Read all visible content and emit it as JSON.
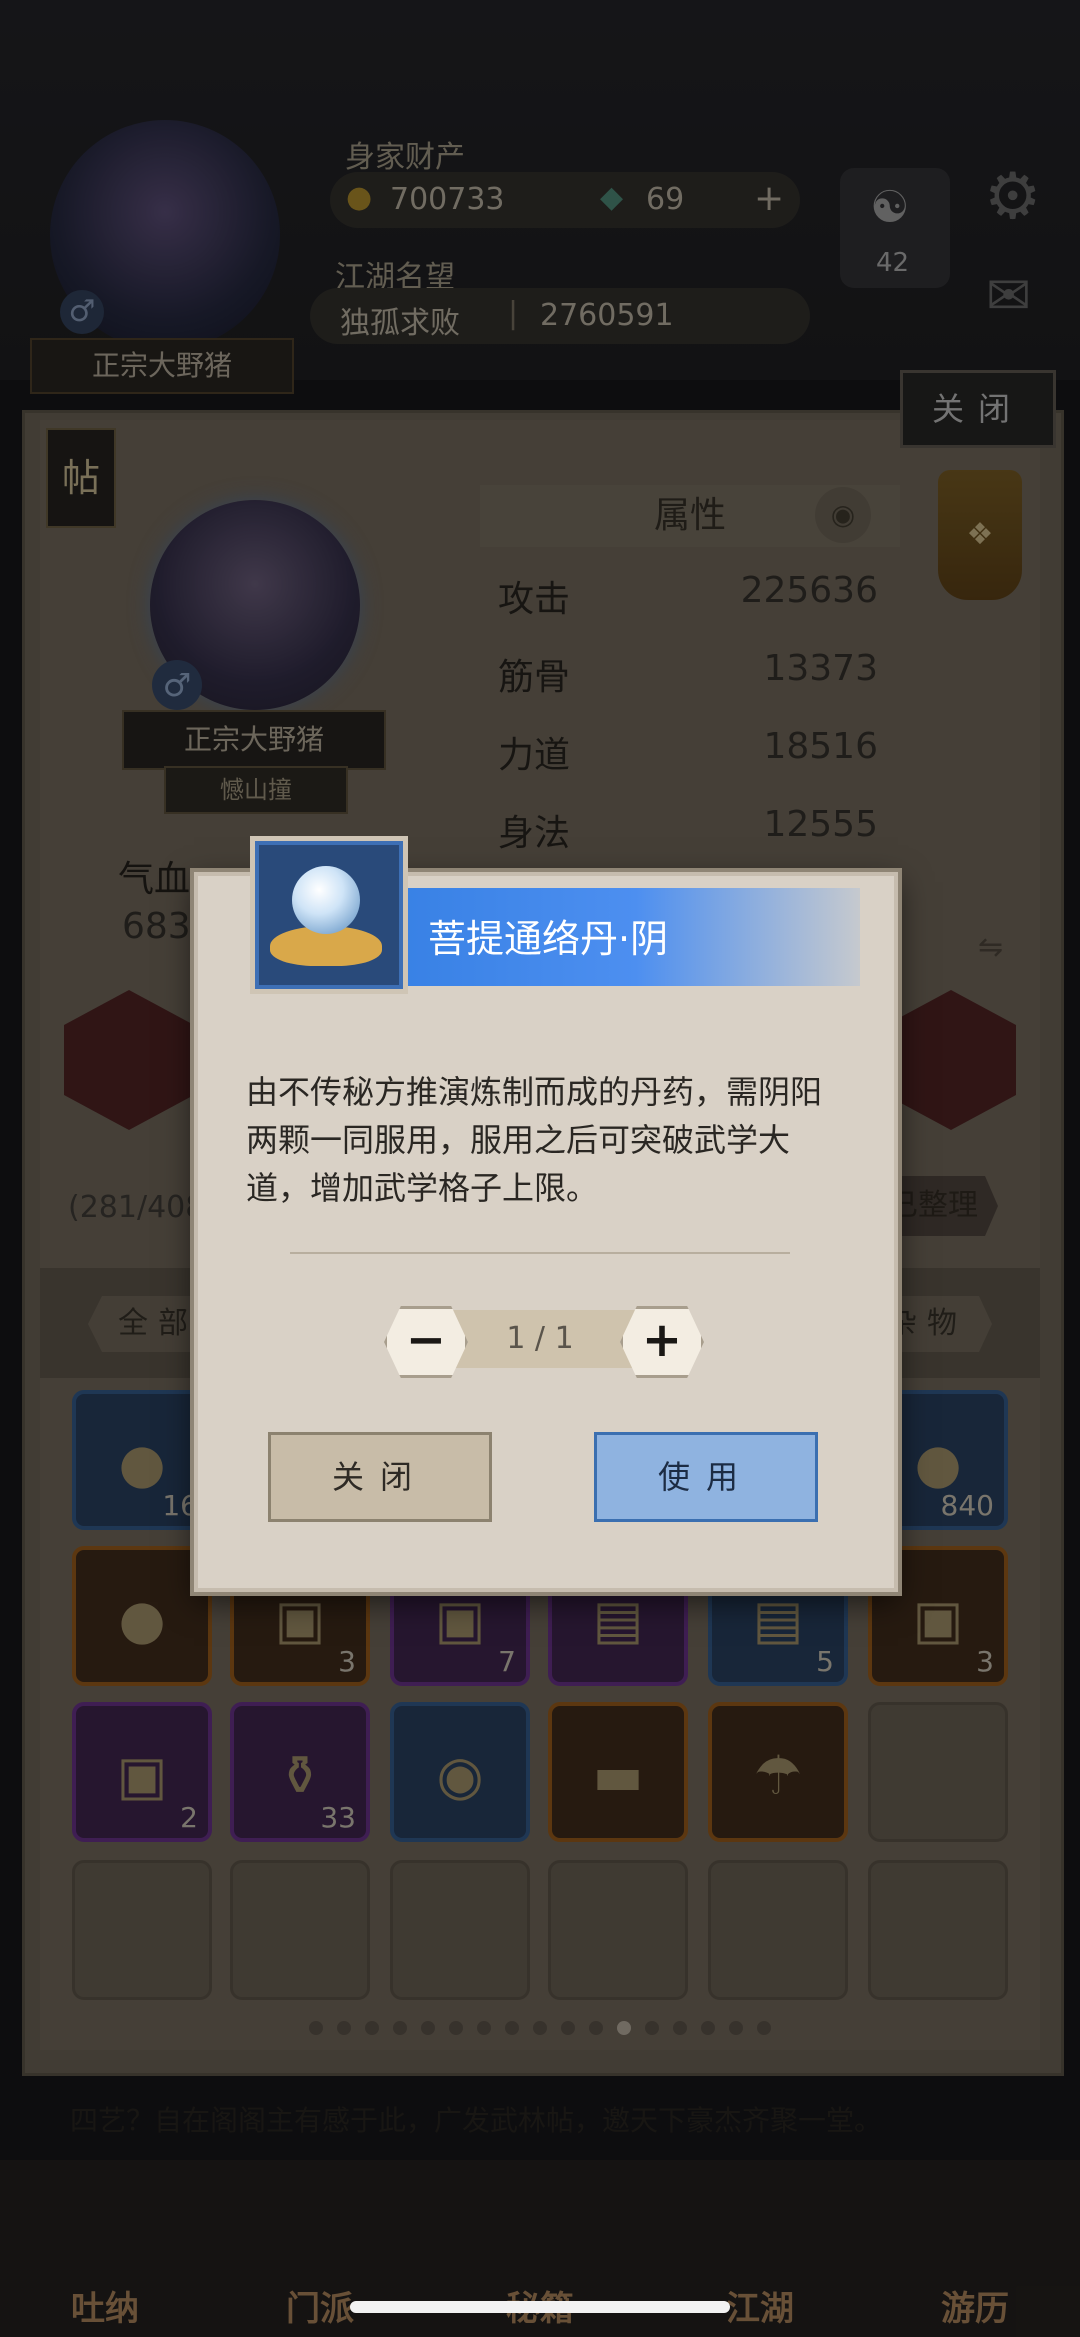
{
  "top": {
    "wealth_label": "身家财产",
    "gold": "700733",
    "jade": "69",
    "plus": "+",
    "fame_label": "江湖名望",
    "fame_title": "独孤求败",
    "fame_value": "2760591",
    "taiji_level": "42",
    "player_name": "正宗大野猪"
  },
  "panel": {
    "close_tab": "关闭",
    "tie": "帖",
    "hero_name": "正宗大野猪",
    "hero_title": "憾山撞",
    "qixue_label": "气血",
    "qixue_value": "683",
    "attributes_title": "属性",
    "attributes": [
      {
        "label": "攻击",
        "value": "225636"
      },
      {
        "label": "筋骨",
        "value": "13373"
      },
      {
        "label": "力道",
        "value": "18516"
      },
      {
        "label": "身法",
        "value": "12555"
      }
    ],
    "bag_count": "(281/408",
    "sort_button": "已整理",
    "filter_all": "全部",
    "filter_misc": "杂物"
  },
  "inventory": [
    {
      "q": "blue",
      "qty": "16",
      "glyph": "●"
    },
    {
      "q": "blue",
      "qty": "840",
      "glyph": "●"
    },
    {
      "q": "orange",
      "qty": "",
      "glyph": "●"
    },
    {
      "q": "orange",
      "qty": "3",
      "glyph": "▣"
    },
    {
      "q": "purple",
      "qty": "7",
      "glyph": "▣"
    },
    {
      "q": "purple",
      "qty": "",
      "glyph": "▤"
    },
    {
      "q": "blue",
      "qty": "5",
      "glyph": "▤"
    },
    {
      "q": "orange",
      "qty": "3",
      "glyph": "▣"
    },
    {
      "q": "purple",
      "qty": "2",
      "glyph": "▣"
    },
    {
      "q": "purple",
      "qty": "33",
      "glyph": "⚱"
    },
    {
      "q": "blue",
      "qty": "",
      "glyph": "◉"
    },
    {
      "q": "orange",
      "qty": "",
      "glyph": "▬"
    },
    {
      "q": "orange",
      "qty": "",
      "glyph": "☂"
    }
  ],
  "pager": {
    "total": 17,
    "active": 11
  },
  "bottom_text": "四艺？自在阁阁主有感于此，广发武林帖，邀天下豪杰齐聚一堂。",
  "nav": [
    "吐纳",
    "门派",
    "秘籍",
    "江湖",
    "游历"
  ],
  "modal": {
    "title": "菩提通络丹·阴",
    "description": "由不传秘方推演炼制而成的丹药，需阴阳两颗一同服用，服用之后可突破武学大道，增加武学格子上限。",
    "quantity": "1 / 1",
    "minus": "−",
    "plus": "+",
    "close_button": "关闭",
    "use_button": "使用"
  },
  "colors": {
    "title_blue": "#2f7be0",
    "use_button": "#8fb3e0",
    "modal_bg": "#d9d1c6"
  }
}
